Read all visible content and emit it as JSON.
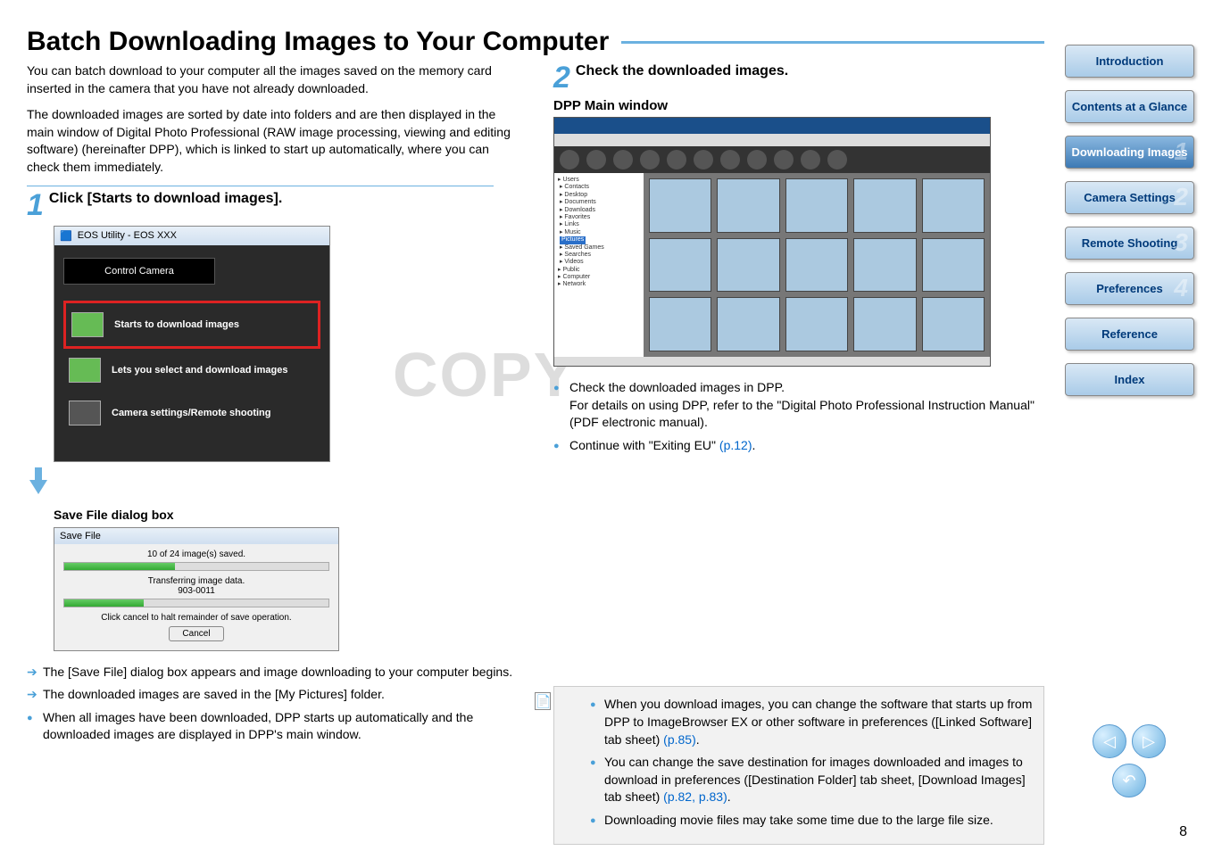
{
  "title": "Batch Downloading Images to Your Computer",
  "intro1": "You can batch download to your computer all the images saved on the memory card inserted in the camera that you have not already downloaded.",
  "intro2": "The downloaded images are sorted by date into folders and are then displayed in the main window of Digital Photo Professional (RAW image processing, viewing and editing software) (hereinafter DPP), which is linked to start up automatically, where you can check them immediately.",
  "step1": {
    "num": "1",
    "title": "Click [Starts to download images]."
  },
  "eos": {
    "titlebar": "EOS Utility - EOS XXX",
    "control": "Control Camera",
    "download": "Starts to download images",
    "select": "Lets you select and download images",
    "remote": "Camera settings/Remote shooting"
  },
  "savefile": {
    "caption": "Save File dialog box",
    "title": "Save File",
    "status1": "10 of 24 image(s) saved.",
    "status2": "Transferring image data.",
    "filename": "903-0011",
    "status3": "Click cancel to halt remainder of save operation.",
    "cancel": "Cancel"
  },
  "bulletsL": {
    "a": "The [Save File] dialog box appears and image downloading to your computer begins.",
    "b": "The downloaded images are saved in the [My Pictures] folder.",
    "c": "When all images have been downloaded, DPP starts up automatically and the downloaded images are displayed in DPP's main window."
  },
  "step2": {
    "num": "2",
    "title": "Check the downloaded images.",
    "sub": "DPP Main window"
  },
  "bulletsR": {
    "a": "Check the downloaded images in DPP.",
    "a2": "For details on using DPP, refer to the \"Digital Photo Professional Instruction Manual\" (PDF electronic manual).",
    "b": "Continue with \"Exiting EU\" ",
    "b_link": "(p.12)"
  },
  "notes": {
    "n1a": "When you download images, you can change the software that starts up from DPP to ImageBrowser EX or other software in preferences ([Linked Software] tab sheet) ",
    "n1l": "(p.85)",
    "n2a": "You can change the save destination for images downloaded and images to download in preferences ([Destination Folder] tab sheet, [Download Images] tab sheet) ",
    "n2l": "(p.82, p.83)",
    "n3": "Downloading movie files may take some time due to the large file size."
  },
  "sidebar": {
    "intro": "Introduction",
    "contents": "Contents at a Glance",
    "download": "Downloading Images",
    "camera": "Camera Settings",
    "remote": "Remote Shooting",
    "prefs": "Preferences",
    "ref": "Reference",
    "index": "Index"
  },
  "page_num": "8",
  "watermark": "COPY"
}
